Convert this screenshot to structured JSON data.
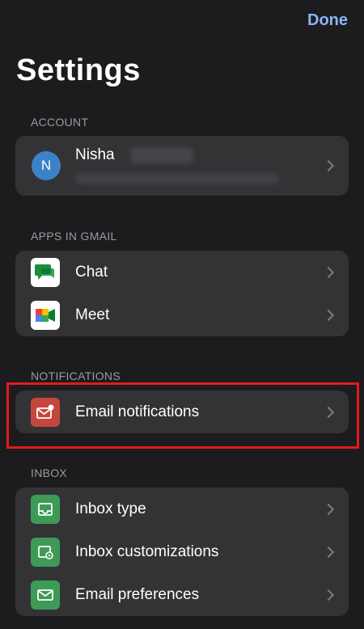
{
  "header": {
    "done_label": "Done",
    "title": "Settings"
  },
  "account": {
    "section": "ACCOUNT",
    "avatar_initial": "N",
    "name": "Nisha"
  },
  "apps": {
    "section": "APPS IN GMAIL",
    "items": [
      {
        "label": "Chat",
        "icon": "google-chat-icon"
      },
      {
        "label": "Meet",
        "icon": "google-meet-icon"
      }
    ]
  },
  "notifications": {
    "section": "NOTIFICATIONS",
    "items": [
      {
        "label": "Email notifications",
        "icon": "email-notifications-icon"
      }
    ]
  },
  "inbox": {
    "section": "INBOX",
    "items": [
      {
        "label": "Inbox type",
        "icon": "inbox-icon"
      },
      {
        "label": "Inbox customizations",
        "icon": "inbox-customize-icon"
      },
      {
        "label": "Email preferences",
        "icon": "mail-icon"
      }
    ]
  },
  "colors": {
    "accent": "#8ab4f8",
    "highlight": "#e31b1b",
    "notif_icon": "#c5473b",
    "inbox_icon": "#3e9a57"
  }
}
